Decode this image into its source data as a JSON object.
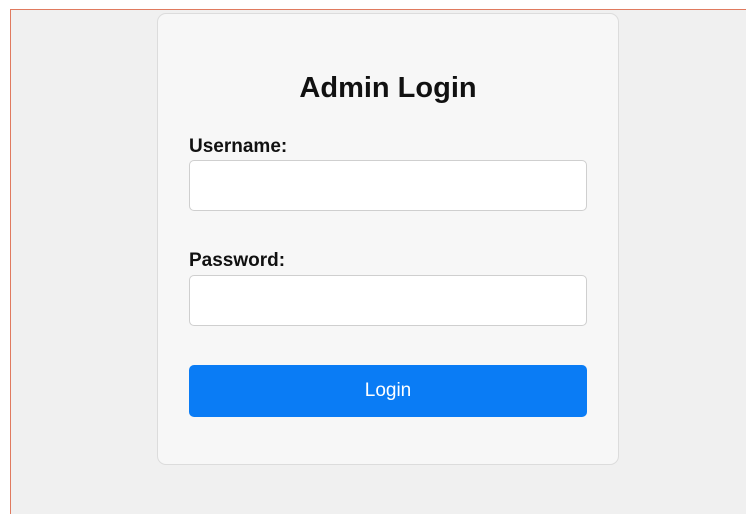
{
  "login_form": {
    "title": "Admin Login",
    "username_label": "Username:",
    "username_value": "",
    "password_label": "Password:",
    "password_value": "",
    "submit_label": "Login"
  },
  "colors": {
    "page_background": "#f0f0f0",
    "card_background": "#f7f7f7",
    "button_background": "#0a7cf5",
    "button_text": "#ffffff",
    "frame_accent": "#e07a5f"
  }
}
